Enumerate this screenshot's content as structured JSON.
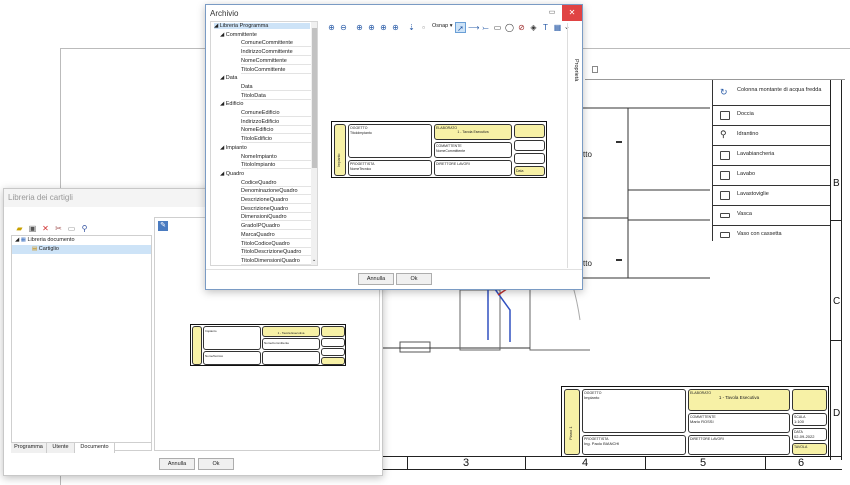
{
  "cad": {
    "legend": [
      {
        "label": "Colonna montante di acqua fredda",
        "icon": "riser-icon"
      },
      {
        "label": "Doccia",
        "icon": "shower-icon"
      },
      {
        "label": "Idrantino",
        "icon": "hydrant-icon"
      },
      {
        "label": "Lavabiancheria",
        "icon": "washing-machine-icon"
      },
      {
        "label": "Lavabo",
        "icon": "sink-icon"
      },
      {
        "label": "Lavastoviglie",
        "icon": "dishwasher-icon"
      },
      {
        "label": "Vasca",
        "icon": "bathtub-icon"
      },
      {
        "label": "Vaso con cassetta",
        "icon": "toilet-icon"
      }
    ],
    "row_labels": [
      "B",
      "C",
      "D"
    ],
    "col_labels": [
      "3",
      "4",
      "5",
      "6"
    ],
    "room_text_1": "tto",
    "room_text_2": "tto",
    "title_block": {
      "oggetto_label": "OGGETTO",
      "oggetto_value": "Impianto",
      "elaborato_label": "ELABORATO",
      "elaborato_value": "1 - Tavola Esecutiva",
      "committente_label": "COMMITTENTE",
      "committente_value": "Mario ROSSI",
      "progettista_label": "PROGETTISTA",
      "progettista_value": "Ing. Paolo BIANCHI",
      "direttore_label": "DIRETTORE LAVORI",
      "side_label": "Piano 1",
      "scala_label": "SCALA",
      "scala_value": "1:100",
      "data_label": "DATA",
      "data_value": "02-09-2022",
      "tavola_label": "TAVOLA"
    }
  },
  "library_window": {
    "title": "Libreria dei cartigli",
    "tree": {
      "root": "Libreria documento",
      "child": "Cartiglio"
    },
    "tabs": [
      "Programma",
      "Utente",
      "Documento"
    ],
    "active_tab": "Documento",
    "preview": {
      "elaborato_value": "1 - Tavola Esecutiva",
      "oggetto_value": "Impianto",
      "committente_value": "NomeCommittente",
      "progettista_value": "NomeTecnico"
    },
    "buttons": {
      "cancel": "Annulla",
      "ok": "Ok"
    }
  },
  "archivio_window": {
    "title": "Archivio",
    "side_tab": "Proprietà",
    "osnap_label": "Osnap",
    "tree": [
      {
        "label": "Libreria Programma",
        "level": 0
      },
      {
        "label": "Committente",
        "level": 1
      },
      {
        "label": "ComuneCommittente",
        "level": 2
      },
      {
        "label": "IndirizzoCommittente",
        "level": 2
      },
      {
        "label": "NomeCommittente",
        "level": 2
      },
      {
        "label": "TitoloCommittente",
        "level": 2
      },
      {
        "label": "Data",
        "level": 1
      },
      {
        "label": "Data",
        "level": 2
      },
      {
        "label": "TitoloData",
        "level": 2
      },
      {
        "label": "Edificio",
        "level": 1
      },
      {
        "label": "ComuneEdificio",
        "level": 2
      },
      {
        "label": "IndirizzoEdificio",
        "level": 2
      },
      {
        "label": "NomeEdificio",
        "level": 2
      },
      {
        "label": "TitoloEdificio",
        "level": 2
      },
      {
        "label": "Impianto",
        "level": 1
      },
      {
        "label": "NomeImpianto",
        "level": 2
      },
      {
        "label": "TitoloImpianto",
        "level": 2
      },
      {
        "label": "Quadro",
        "level": 1
      },
      {
        "label": "CodiceQuadro",
        "level": 2
      },
      {
        "label": "DenominazioneQuadro",
        "level": 2
      },
      {
        "label": "DescrizioneQuadro",
        "level": 2
      },
      {
        "label": "DescrizioneQuadro",
        "level": 2
      },
      {
        "label": "DimensioniQuadro",
        "level": 2
      },
      {
        "label": "GradoIPQuadro",
        "level": 2
      },
      {
        "label": "MarcaQuadro",
        "level": 2
      },
      {
        "label": "TitoloCodiceQuadro",
        "level": 2
      },
      {
        "label": "TitoloDescrizioneQuadro",
        "level": 2
      },
      {
        "label": "TitoloDimensioniQuadro",
        "level": 2
      }
    ],
    "preview": {
      "oggetto_label": "OGGETTO",
      "oggetto_value": "TitoloImpianto",
      "elaborato_label": "ELABORATO",
      "elaborato_value": "1 - Tavola Esecutiva",
      "committente_label": "COMMITTENTE",
      "committente_value": "NomeCommittente",
      "progettista_label": "PROGETTISTA",
      "progettista_value": "NomeTecnico",
      "direttore_label": "DIRETTORE LAVORI",
      "side_label": "Impianto",
      "data_value": "Data"
    },
    "buttons": {
      "cancel": "Annulla",
      "ok": "Ok"
    }
  }
}
